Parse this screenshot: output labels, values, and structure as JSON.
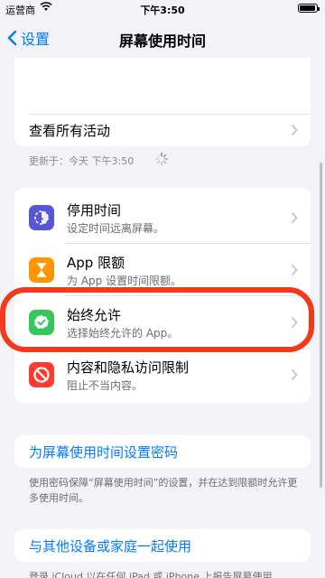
{
  "status": {
    "carrier": "运营商",
    "time": "下午3:50"
  },
  "nav": {
    "back_label": "设置",
    "title": "屏幕使用时间"
  },
  "activity": {
    "label": "查看所有活动"
  },
  "updated": {
    "text": "更新于：今天 下午3:50"
  },
  "items": [
    {
      "title": "停用时间",
      "subtitle": "设定时间远离屏幕。",
      "icon": "downtime-icon",
      "color": "#5856d6"
    },
    {
      "title": "App 限额",
      "subtitle": "为 App 设置时间限额。",
      "icon": "hourglass-icon",
      "color": "#ff9500"
    },
    {
      "title": "始终允许",
      "subtitle": "选择始终允许的 App。",
      "icon": "check-badge-icon",
      "color": "#34c759"
    },
    {
      "title": "内容和隐私访问限制",
      "subtitle": "阻止不当内容。",
      "icon": "restriction-icon",
      "color": "#ff3b30"
    }
  ],
  "passcode": {
    "link": "为屏幕使用时间设置密码",
    "note": "使用密码保障“屏幕使用时间”的设置，并在达到限额时允许更多使用时间。"
  },
  "share": {
    "link": "与其他设备或家庭一起使用",
    "note": "登录 iCloud 以在任何 iPad 或 iPhone 上报告屏幕使用"
  },
  "colors": {
    "accent": "#007aff",
    "highlight": "#f23a1b",
    "background": "#f2f2f7"
  }
}
